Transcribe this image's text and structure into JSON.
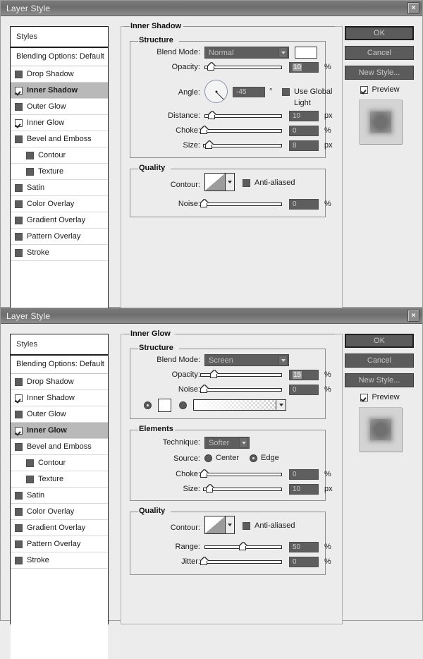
{
  "colors": {
    "dialog_bg": "#ececec",
    "titlebar": "#6e6e6e",
    "selected_row": "#b9b9b9",
    "field_bg": "#5e5e5e",
    "field_text": "#c9c9c9"
  },
  "dialogs": [
    {
      "title": "Layer Style",
      "close_label": "×",
      "styles_panel": {
        "header": "Styles",
        "blending_options": "Blending Options: Default",
        "items": [
          {
            "label": "Drop Shadow",
            "checked": false,
            "selected": false,
            "indent": false
          },
          {
            "label": "Inner Shadow",
            "checked": true,
            "selected": true,
            "indent": false
          },
          {
            "label": "Outer Glow",
            "checked": false,
            "selected": false,
            "indent": false
          },
          {
            "label": "Inner Glow",
            "checked": true,
            "selected": false,
            "indent": false
          },
          {
            "label": "Bevel and Emboss",
            "checked": false,
            "selected": false,
            "indent": false
          },
          {
            "label": "Contour",
            "checked": false,
            "selected": false,
            "indent": true
          },
          {
            "label": "Texture",
            "checked": false,
            "selected": false,
            "indent": true
          },
          {
            "label": "Satin",
            "checked": false,
            "selected": false,
            "indent": false
          },
          {
            "label": "Color Overlay",
            "checked": false,
            "selected": false,
            "indent": false
          },
          {
            "label": "Gradient Overlay",
            "checked": false,
            "selected": false,
            "indent": false
          },
          {
            "label": "Pattern Overlay",
            "checked": false,
            "selected": false,
            "indent": false
          },
          {
            "label": "Stroke",
            "checked": false,
            "selected": false,
            "indent": false
          }
        ]
      },
      "panel_title": "Inner Shadow",
      "sections": [
        {
          "title": "Structure",
          "fields": {
            "blend_mode_label": "Blend Mode:",
            "blend_mode_value": "Normal",
            "opacity_label": "Opacity:",
            "opacity_value": "10",
            "opacity_unit": "%",
            "opacity_percent": 10,
            "angle_label": "Angle:",
            "angle_value": "-45",
            "angle_unit": "°",
            "use_global_light": "Use Global Light",
            "use_global_light_checked": false,
            "distance_label": "Distance:",
            "distance_value": "10",
            "distance_unit": "px",
            "distance_percent": 8,
            "choke_label": "Choke:",
            "choke_value": "0",
            "choke_unit": "%",
            "choke_percent": 0,
            "size_label": "Size:",
            "size_value": "8",
            "size_unit": "px",
            "size_percent": 6
          }
        },
        {
          "title": "Quality",
          "fields": {
            "contour_label": "Contour:",
            "anti_aliased": "Anti-aliased",
            "anti_aliased_checked": false,
            "noise_label": "Noise:",
            "noise_value": "0",
            "noise_unit": "%",
            "noise_percent": 0
          }
        }
      ],
      "buttons": {
        "ok": "OK",
        "cancel": "Cancel",
        "new_style": "New Style...",
        "preview": "Preview",
        "preview_checked": true
      }
    },
    {
      "title": "Layer Style",
      "close_label": "×",
      "styles_panel": {
        "header": "Styles",
        "blending_options": "Blending Options: Default",
        "items": [
          {
            "label": "Drop Shadow",
            "checked": false,
            "selected": false,
            "indent": false
          },
          {
            "label": "Inner Shadow",
            "checked": true,
            "selected": false,
            "indent": false
          },
          {
            "label": "Outer Glow",
            "checked": false,
            "selected": false,
            "indent": false
          },
          {
            "label": "Inner Glow",
            "checked": true,
            "selected": true,
            "indent": false
          },
          {
            "label": "Bevel and Emboss",
            "checked": false,
            "selected": false,
            "indent": false
          },
          {
            "label": "Contour",
            "checked": false,
            "selected": false,
            "indent": true
          },
          {
            "label": "Texture",
            "checked": false,
            "selected": false,
            "indent": true
          },
          {
            "label": "Satin",
            "checked": false,
            "selected": false,
            "indent": false
          },
          {
            "label": "Color Overlay",
            "checked": false,
            "selected": false,
            "indent": false
          },
          {
            "label": "Gradient Overlay",
            "checked": false,
            "selected": false,
            "indent": false
          },
          {
            "label": "Pattern Overlay",
            "checked": false,
            "selected": false,
            "indent": false
          },
          {
            "label": "Stroke",
            "checked": false,
            "selected": false,
            "indent": false
          }
        ]
      },
      "panel_title": "Inner Glow",
      "sections": [
        {
          "title": "Structure",
          "fields": {
            "blend_mode_label": "Blend Mode:",
            "blend_mode_value": "Screen",
            "opacity_label": "Opacity:",
            "opacity_value": "15",
            "opacity_unit": "%",
            "opacity_percent": 15,
            "noise_label": "Noise:",
            "noise_value": "0",
            "noise_unit": "%",
            "noise_percent": 0,
            "fill_color_selected": true,
            "fill_gradient_selected": false
          }
        },
        {
          "title": "Elements",
          "fields": {
            "technique_label": "Technique:",
            "technique_value": "Softer",
            "source_label": "Source:",
            "source_center": "Center",
            "source_edge": "Edge",
            "source_selected": "Edge",
            "choke_label": "Choke:",
            "choke_value": "0",
            "choke_unit": "%",
            "choke_percent": 0,
            "size_label": "Size:",
            "size_value": "10",
            "size_unit": "px",
            "size_percent": 8
          }
        },
        {
          "title": "Quality",
          "fields": {
            "contour_label": "Contour:",
            "anti_aliased": "Anti-aliased",
            "anti_aliased_checked": false,
            "range_label": "Range:",
            "range_value": "50",
            "range_unit": "%",
            "range_percent": 50,
            "jitter_label": "Jitter:",
            "jitter_value": "0",
            "jitter_unit": "%",
            "jitter_percent": 0
          }
        }
      ],
      "buttons": {
        "ok": "OK",
        "cancel": "Cancel",
        "new_style": "New Style...",
        "preview": "Preview",
        "preview_checked": true
      }
    }
  ]
}
